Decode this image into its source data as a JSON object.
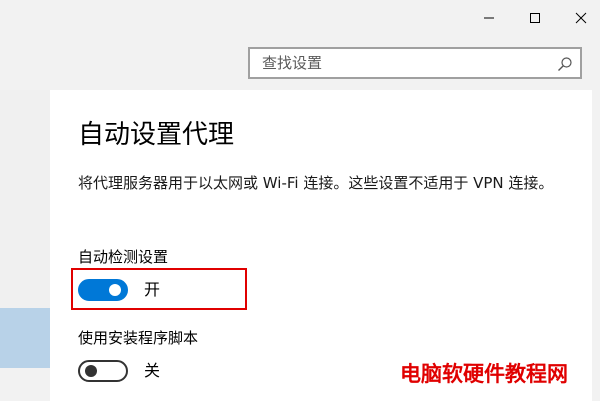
{
  "window": {
    "minimize_icon": "minimize-icon",
    "maximize_icon": "maximize-icon",
    "close_icon": "close-icon"
  },
  "search": {
    "placeholder": "查找设置",
    "icon": "search-icon"
  },
  "page": {
    "title": "自动设置代理",
    "description": "将代理服务器用于以太网或 Wi-Fi 连接。这些设置不适用于 VPN 连接。"
  },
  "settings": [
    {
      "label": "自动检测设置",
      "state_label": "开",
      "on": true
    },
    {
      "label": "使用安装程序脚本",
      "state_label": "关",
      "on": false
    }
  ],
  "watermark": {
    "text": "电脑软硬件教程网",
    "color": "#e00000"
  },
  "colors": {
    "accent": "#0078d7",
    "highlight_border": "#e00000",
    "nav_selected": "#b8d2e8"
  }
}
